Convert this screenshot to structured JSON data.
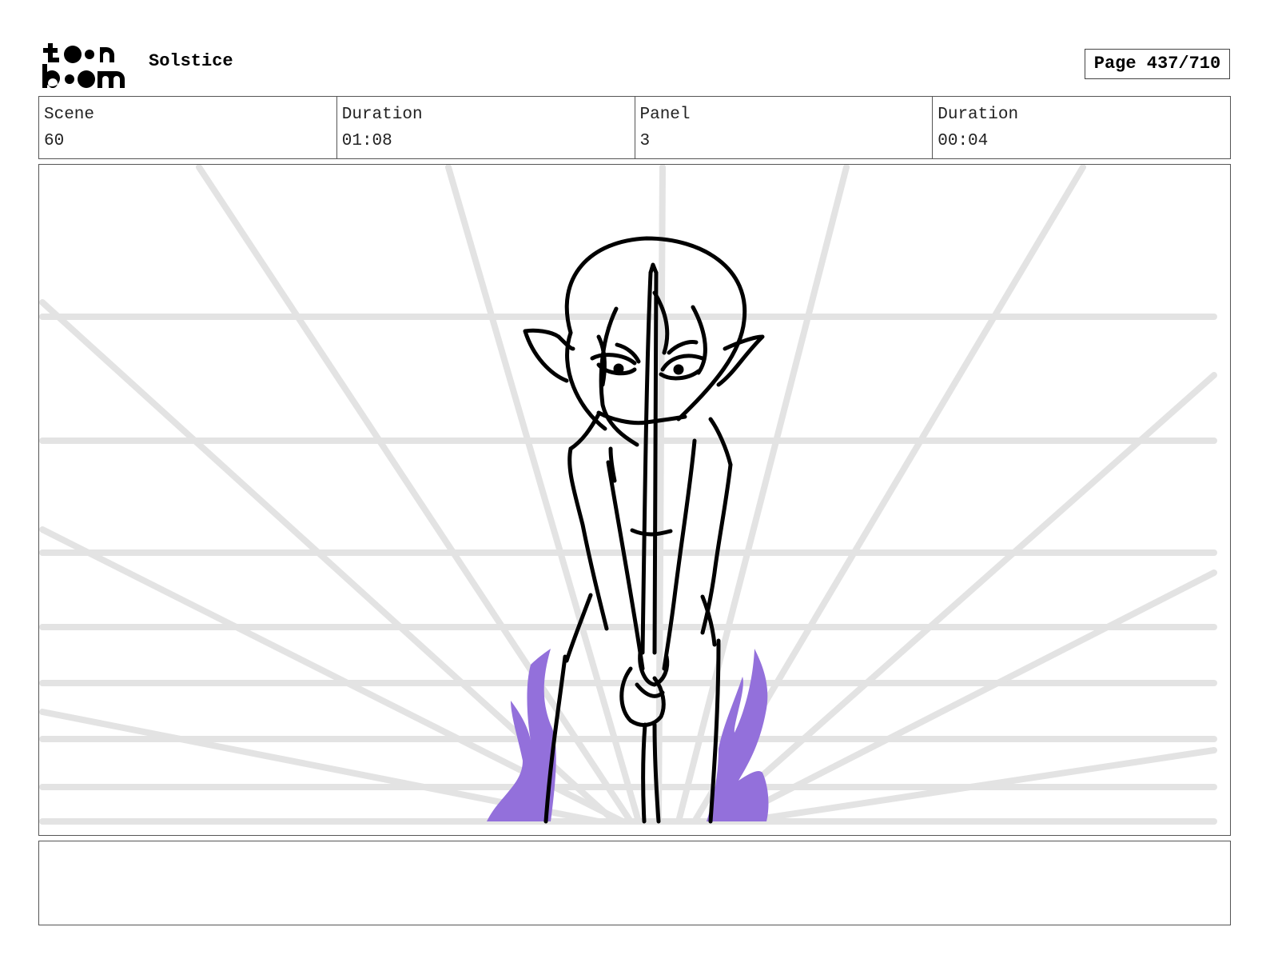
{
  "header": {
    "logo_text": "toon boom",
    "project_title": "Solstice",
    "page_label": "Page 437/710"
  },
  "info": {
    "scene_label": "Scene",
    "scene_value": "60",
    "scene_duration_label": "Duration",
    "scene_duration_value": "01:08",
    "panel_label": "Panel",
    "panel_value": "3",
    "panel_duration_label": "Duration",
    "panel_duration_value": "00:04"
  },
  "panel": {
    "drawing": "sketch-elf-character-holding-sword",
    "flame_color": "#9370db",
    "guide_line_color": "#e3e3e3"
  },
  "caption": {
    "text": ""
  }
}
